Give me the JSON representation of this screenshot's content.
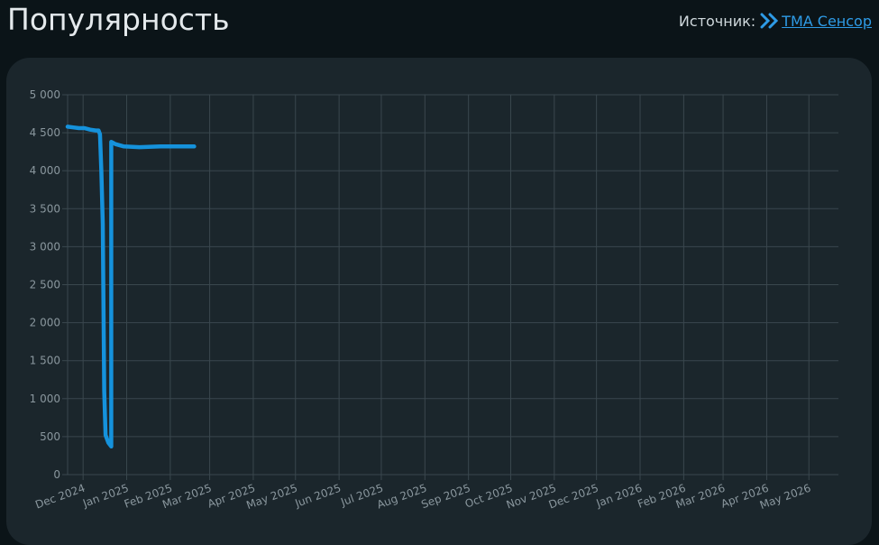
{
  "header": {
    "title": "Популярность",
    "source_label": "Источник:",
    "source_link": "TMA Сенсор",
    "source_icon": "tma-sensor-logo-icon"
  },
  "colors": {
    "background": "#0b1418",
    "card": "#1b262c",
    "line": "#1592dc",
    "grid": "#3a474e",
    "link": "#2e9be6"
  },
  "chart_data": {
    "type": "line",
    "title": "",
    "xlabel": "",
    "ylabel": "",
    "ylim": [
      0,
      5000
    ],
    "xlim": [
      "2024-11-20",
      "2026-05-22"
    ],
    "y_ticks": [
      "0",
      "500",
      "1 000",
      "1 500",
      "2 000",
      "2 500",
      "3 000",
      "3 500",
      "4 000",
      "4 500",
      "5 000"
    ],
    "x_ticks": [
      {
        "date": "2024-12-01",
        "label": "Dec 2024"
      },
      {
        "date": "2025-01-01",
        "label": "Jan 2025"
      },
      {
        "date": "2025-02-01",
        "label": "Feb 2025"
      },
      {
        "date": "2025-03-01",
        "label": "Mar 2025"
      },
      {
        "date": "2025-04-01",
        "label": "Apr 2025"
      },
      {
        "date": "2025-05-01",
        "label": "May 2025"
      },
      {
        "date": "2025-06-01",
        "label": "Jun 2025"
      },
      {
        "date": "2025-07-01",
        "label": "Jul 2025"
      },
      {
        "date": "2025-08-01",
        "label": "Aug 2025"
      },
      {
        "date": "2025-09-01",
        "label": "Sep 2025"
      },
      {
        "date": "2025-10-01",
        "label": "Oct 2025"
      },
      {
        "date": "2025-11-01",
        "label": "Nov 2025"
      },
      {
        "date": "2025-12-01",
        "label": "Dec 2025"
      },
      {
        "date": "2026-01-01",
        "label": "Jan 2026"
      },
      {
        "date": "2026-02-01",
        "label": "Feb 2026"
      },
      {
        "date": "2026-03-01",
        "label": "Mar 2026"
      },
      {
        "date": "2026-04-01",
        "label": "Apr 2026"
      },
      {
        "date": "2026-05-01",
        "label": "May 2026"
      }
    ],
    "grid": true,
    "series": [
      {
        "values": [
          {
            "x": "2024-11-20",
            "y": 4580
          },
          {
            "x": "2024-11-24",
            "y": 4570
          },
          {
            "x": "2024-11-28",
            "y": 4560
          },
          {
            "x": "2024-12-02",
            "y": 4560
          },
          {
            "x": "2024-12-06",
            "y": 4540
          },
          {
            "x": "2024-12-10",
            "y": 4530
          },
          {
            "x": "2024-12-12",
            "y": 4530
          },
          {
            "x": "2024-12-13",
            "y": 4480
          },
          {
            "x": "2024-12-14",
            "y": 4000
          },
          {
            "x": "2024-12-15",
            "y": 3300
          },
          {
            "x": "2024-12-16",
            "y": 1100
          },
          {
            "x": "2024-12-17",
            "y": 520
          },
          {
            "x": "2024-12-19",
            "y": 420
          },
          {
            "x": "2024-12-21",
            "y": 370
          },
          {
            "x": "2024-12-21",
            "y": 4380
          },
          {
            "x": "2024-12-24",
            "y": 4350
          },
          {
            "x": "2024-12-30",
            "y": 4320
          },
          {
            "x": "2025-01-10",
            "y": 4310
          },
          {
            "x": "2025-01-25",
            "y": 4320
          },
          {
            "x": "2025-02-10",
            "y": 4320
          },
          {
            "x": "2025-02-18",
            "y": 4320
          }
        ]
      }
    ]
  }
}
